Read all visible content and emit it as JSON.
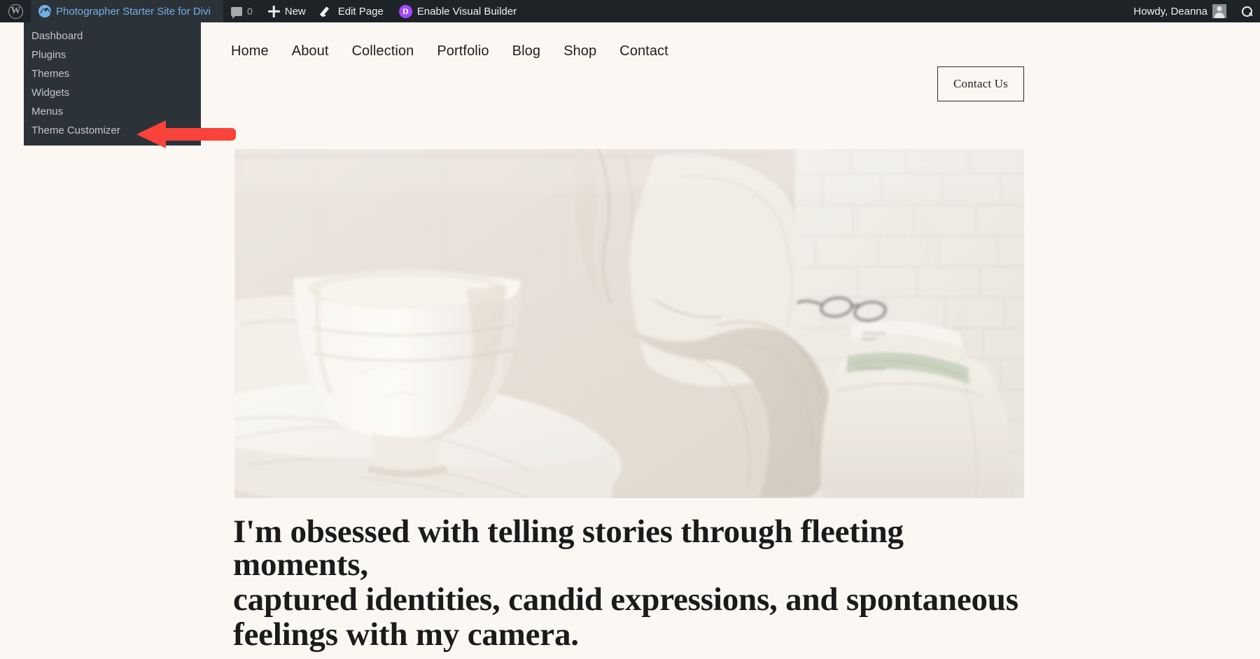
{
  "admin_bar": {
    "wp_logo_icon": "wordpress-logo-icon",
    "site_title": "Photographer Starter Site for Divi",
    "site_icon": "dashboard-speedometer-icon",
    "comments_icon": "comment-bubble-icon",
    "comments_count": "0",
    "new_icon": "plus-icon",
    "new_label": "New",
    "edit_icon": "pencil-icon",
    "edit_label": "Edit Page",
    "divi_icon": "divi-d-icon",
    "divi_label": "Enable Visual Builder",
    "howdy": "Howdy, Deanna",
    "avatar_icon": "user-avatar-icon",
    "search_icon": "search-icon",
    "bg_color": "#1d2327",
    "link_color": "#72aee6",
    "text_color": "#f0f0f1"
  },
  "admin_dropdown": {
    "bg_color": "#2c3338",
    "items": [
      {
        "label": "Dashboard"
      },
      {
        "label": "Plugins"
      },
      {
        "label": "Themes"
      },
      {
        "label": "Widgets"
      },
      {
        "label": "Menus"
      },
      {
        "label": "Theme Customizer"
      }
    ]
  },
  "annotation": {
    "arrow_icon": "red-left-arrow-icon",
    "arrow_color": "#f9423a",
    "points_at": "Theme Customizer"
  },
  "site_header": {
    "nav_items": [
      {
        "label": "Home"
      },
      {
        "label": "About"
      },
      {
        "label": "Collection"
      },
      {
        "label": "Portfolio"
      },
      {
        "label": "Blog"
      },
      {
        "label": "Shop"
      },
      {
        "label": "Contact"
      }
    ],
    "cta_label": "Contact Us"
  },
  "hero": {
    "image_alt": "White ceramic bowl on a marble side table with linen throw over an armchair, books and glasses, white brick wall",
    "heading_lines": [
      "I'm obsessed with telling stories through fleeting moments,",
      "captured identities, candid expressions, and spontaneous",
      "feelings with my camera."
    ]
  },
  "theme": {
    "page_bg": "#fbf8f4",
    "text_color": "#1b1b1b"
  }
}
